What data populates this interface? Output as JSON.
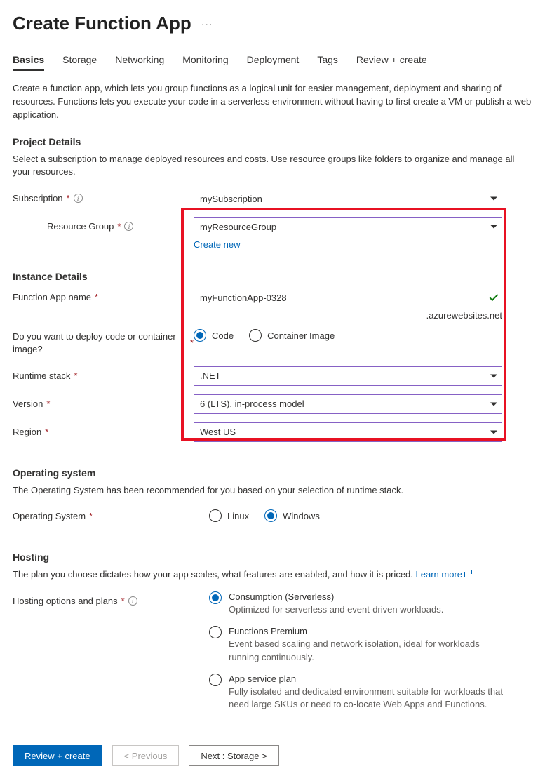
{
  "title": "Create Function App",
  "tabs": [
    "Basics",
    "Storage",
    "Networking",
    "Monitoring",
    "Deployment",
    "Tags",
    "Review + create"
  ],
  "activeTab": 0,
  "intro": "Create a function app, which lets you group functions as a logical unit for easier management, deployment and sharing of resources. Functions lets you execute your code in a serverless environment without having to first create a VM or publish a web application.",
  "projectDetails": {
    "heading": "Project Details",
    "desc": "Select a subscription to manage deployed resources and costs. Use resource groups like folders to organize and manage all your resources.",
    "subscriptionLabel": "Subscription",
    "subscriptionValue": "mySubscription",
    "resourceGroupLabel": "Resource Group",
    "resourceGroupValue": "myResourceGroup",
    "createNew": "Create new"
  },
  "instanceDetails": {
    "heading": "Instance Details",
    "nameLabel": "Function App name",
    "nameValue": "myFunctionApp-0328",
    "nameSuffix": ".azurewebsites.net",
    "deployLabel": "Do you want to deploy code or container image?",
    "deployOptions": [
      "Code",
      "Container Image"
    ],
    "deploySelected": 0,
    "runtimeLabel": "Runtime stack",
    "runtimeValue": ".NET",
    "versionLabel": "Version",
    "versionValue": "6 (LTS), in-process model",
    "regionLabel": "Region",
    "regionValue": "West US"
  },
  "os": {
    "heading": "Operating system",
    "desc": "The Operating System has been recommended for you based on your selection of runtime stack.",
    "label": "Operating System",
    "options": [
      "Linux",
      "Windows"
    ],
    "selected": 1
  },
  "hosting": {
    "heading": "Hosting",
    "desc": "The plan you choose dictates how your app scales, what features are enabled, and how it is priced. ",
    "learnMore": "Learn more",
    "label": "Hosting options and plans",
    "options": [
      {
        "label": "Consumption (Serverless)",
        "desc": "Optimized for serverless and event-driven workloads."
      },
      {
        "label": "Functions Premium",
        "desc": "Event based scaling and network isolation, ideal for workloads running continuously."
      },
      {
        "label": "App service plan",
        "desc": "Fully isolated and dedicated environment suitable for workloads that need large SKUs or need to co-locate Web Apps and Functions."
      }
    ],
    "selected": 0
  },
  "footer": {
    "reviewCreate": "Review + create",
    "previous": "< Previous",
    "next": "Next : Storage >"
  }
}
